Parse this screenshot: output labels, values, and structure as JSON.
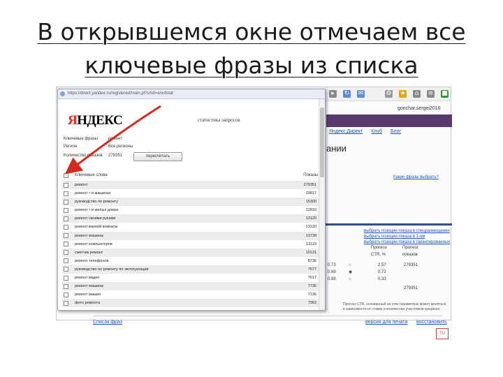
{
  "slide": {
    "title_line1": "В открывшемся окне отмечаем все",
    "title_line2": "ключевые фразы из списка"
  },
  "popup": {
    "url": "https://direct.yandex.ru/registered/main.pl?cmd=wordstat",
    "logo_prefix": "Я",
    "logo_rest": "НДЕКС",
    "stat_title": "статистика запросов",
    "form": {
      "phrases_label": "Ключевые фразы",
      "phrases_value": "ремонт",
      "region_label": "Регион",
      "region_value": "Все регионы",
      "shows_label": "Количество показов",
      "shows_value": "279351",
      "refresh_button": "пересчитать"
    },
    "header": {
      "select_all_label": "Ключевые слова",
      "shows_column": "Показы"
    },
    "rows": [
      {
        "phrase": "ремонт",
        "count": "279351"
      },
      {
        "phrase": "ремонт т в машинах",
        "count": "19817"
      },
      {
        "phrase": "руководство по ремонту",
        "count": "15300"
      },
      {
        "phrase": "ремонт т в жилых домах",
        "count": "12810"
      },
      {
        "phrase": "ремонт своими руками",
        "count": "13120"
      },
      {
        "phrase": "ремонт ванной комнаты",
        "count": "13120"
      },
      {
        "phrase": "ремонт машины",
        "count": "13739"
      },
      {
        "phrase": "ремонт компьютеров",
        "count": "13119"
      },
      {
        "phrase": "сметчик ремонт",
        "count": "10131"
      },
      {
        "phrase": "ремонт телефонов",
        "count": "8736"
      },
      {
        "phrase": "руководство по ремонту по эксплуатации",
        "count": "7677"
      },
      {
        "phrase": "ремонт видео",
        "count": "7617"
      },
      {
        "phrase": "ремонт машины",
        "count": "7736"
      },
      {
        "phrase": "ремонт машин",
        "count": "7136"
      },
      {
        "phrase": "фото ремонта",
        "count": "7363"
      }
    ]
  },
  "background": {
    "username": "gonchar.sergei2016",
    "nav_links": [
      "Яндекс.Директ",
      "Клуб",
      "Блог"
    ],
    "big_text": "ании",
    "right_link": "Какие фразы выбрать?",
    "right_links": [
      "выбрать позиции показа в спецразмещении",
      "выбрать позиции показа в 1-ом",
      "выбрать позиции показа в гарантированных"
    ],
    "col_headers": [
      "Прогноз CTR, %",
      "Прогноз показов"
    ],
    "col1": [
      "0.73",
      "0.69",
      "0.88"
    ],
    "col2": [
      "2.57",
      "0.72",
      "0.33"
    ],
    "col3_top": "279351",
    "col3_bottom": "279351",
    "note": "Прогноз CTR, основанный на этих параметрах может меняться в зависимости от ставок и количества участников аукциона",
    "bottom_link": "Список фраз",
    "bottom_link2": "версия для печати",
    "bottom_link3": "восстановить"
  }
}
